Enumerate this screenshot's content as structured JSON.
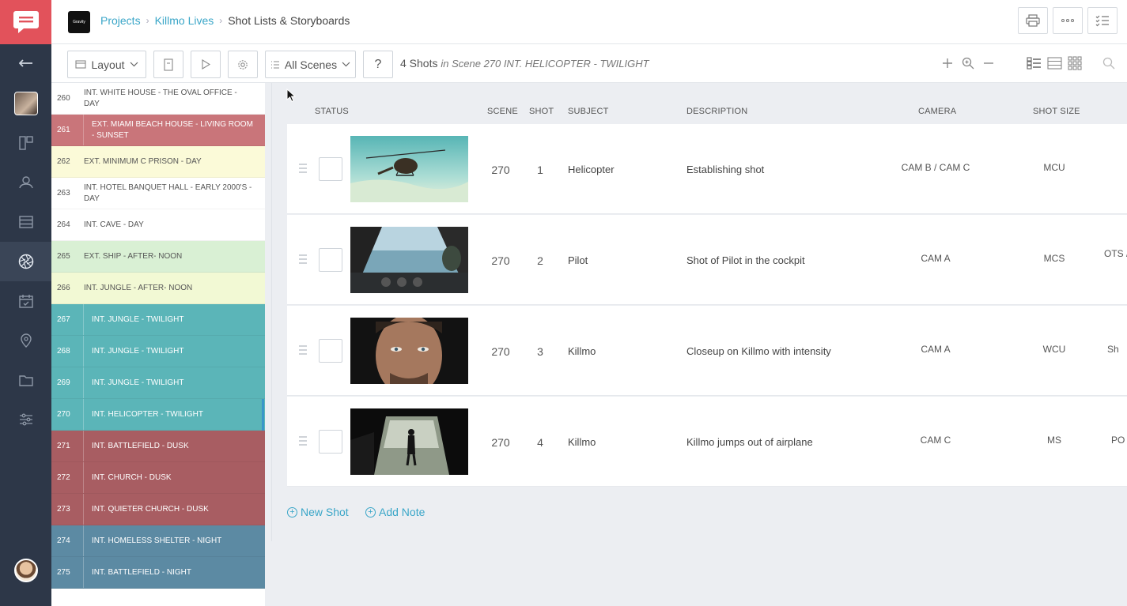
{
  "header": {
    "project_logo_text": "Gravity",
    "breadcrumbs": [
      "Projects",
      "Killmo Lives",
      "Shot Lists & Storyboards"
    ]
  },
  "toolbar": {
    "layout_label": "Layout",
    "scene_filter_label": "All Scenes",
    "help_label": "?",
    "shots_count": "4 Shots",
    "scene_context": "in Scene 270 INT. HELICOPTER - TWILIGHT"
  },
  "scenes": [
    {
      "num": "260",
      "title": "INT. WHITE HOUSE - THE OVAL OFFICE - DAY",
      "color": "#ffffff"
    },
    {
      "num": "261",
      "title": "EXT. MIAMI BEACH HOUSE - LIVING ROOM - SUNSET",
      "color": "#c9757a"
    },
    {
      "num": "262",
      "title": "EXT. MINIMUM C PRISON - DAY",
      "color": "#fbfad8"
    },
    {
      "num": "263",
      "title": "INT. HOTEL BANQUET HALL - EARLY 2000'S - DAY",
      "color": "#ffffff"
    },
    {
      "num": "264",
      "title": "INT. CAVE - DAY",
      "color": "#ffffff"
    },
    {
      "num": "265",
      "title": "EXT. SHIP - AFTER- NOON",
      "color": "#d9f0d4"
    },
    {
      "num": "266",
      "title": "INT. JUNGLE - AFTER- NOON",
      "color": "#f2f9d4"
    },
    {
      "num": "267",
      "title": "INT. JUNGLE - TWILIGHT",
      "color": "#5bb5b8"
    },
    {
      "num": "268",
      "title": "INT. JUNGLE - TWILIGHT",
      "color": "#5bb5b8"
    },
    {
      "num": "269",
      "title": "INT. JUNGLE - TWILIGHT",
      "color": "#5bb5b8"
    },
    {
      "num": "270",
      "title": "INT. HELICOPTER - TWILIGHT",
      "color": "#5bb5b8"
    },
    {
      "num": "271",
      "title": "INT. BATTLEFIELD - DUSK",
      "color": "#a85d62"
    },
    {
      "num": "272",
      "title": "INT. CHURCH - DUSK",
      "color": "#a85d62"
    },
    {
      "num": "273",
      "title": "INT. QUIETER CHURCH - DUSK",
      "color": "#a85d62"
    },
    {
      "num": "274",
      "title": "INT. HOMELESS SHELTER - NIGHT",
      "color": "#5c8aa3"
    },
    {
      "num": "275",
      "title": "INT. BATTLEFIELD - NIGHT",
      "color": "#5c8aa3"
    }
  ],
  "selected_scene": "270",
  "columns": {
    "status": "STATUS",
    "scene": "SCENE",
    "shot": "SHOT",
    "subject": "SUBJECT",
    "description": "DESCRIPTION",
    "camera": "CAMERA",
    "shot_size": "SHOT SIZE"
  },
  "shots": [
    {
      "scene": "270",
      "shot": "1",
      "subject": "Helicopter",
      "description": "Establishing shot",
      "camera": "CAM B / CAM C",
      "shot_size": "MCU",
      "extra": ""
    },
    {
      "scene": "270",
      "shot": "2",
      "subject": "Pilot",
      "description": "Shot of Pilot in the cockpit",
      "camera": "CAM A",
      "shot_size": "MCS",
      "extra": "OTS /"
    },
    {
      "scene": "270",
      "shot": "3",
      "subject": "Killmo",
      "description": "Closeup on Killmo with intensity",
      "camera": "CAM A",
      "shot_size": "WCU",
      "extra": "Sh"
    },
    {
      "scene": "270",
      "shot": "4",
      "subject": "Killmo",
      "description": "Killmo jumps out of airplane",
      "camera": "CAM C",
      "shot_size": "MS",
      "extra": "PO"
    }
  ],
  "actions": {
    "new_shot": "New Shot",
    "add_note": "Add Note"
  },
  "colors": {
    "accent": "#3aa6c8",
    "brand": "#e2525b",
    "rail": "#2d3748"
  }
}
